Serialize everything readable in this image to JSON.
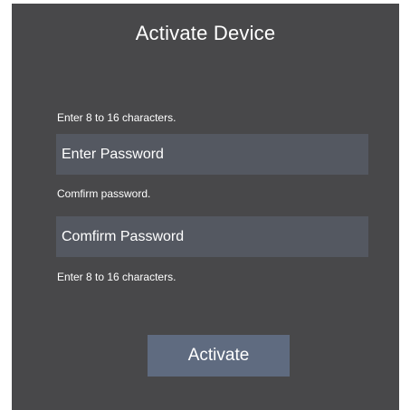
{
  "dialog": {
    "title": "Activate Device",
    "password_hint": "Enter 8 to 16 characters.",
    "password_placeholder": "Enter Password",
    "confirm_hint": "Comfirm password.",
    "confirm_placeholder": "Comfirm Password",
    "bottom_hint": "Enter 8 to 16 characters.",
    "activate_label": "Activate"
  },
  "colors": {
    "panel_bg": "#48484a",
    "field_bg": "#545861",
    "button_bg": "#5f6b80",
    "text": "#ffffff"
  }
}
